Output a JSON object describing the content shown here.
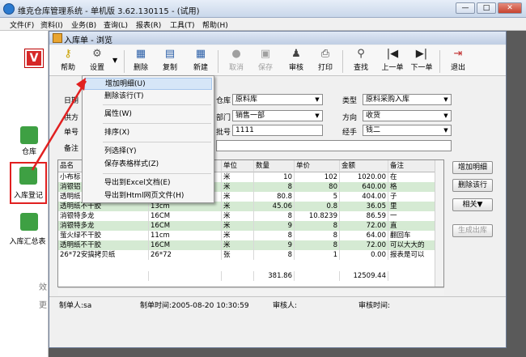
{
  "app": {
    "title": "维克仓库管理系统 - 单机版 3.62.130115 - (试用)",
    "winbtn_min": "—",
    "winbtn_max": "□",
    "winbtn_close": "✕"
  },
  "menu": [
    "文件(F)",
    "资料(I)",
    "业务(B)",
    "查询(L)",
    "报表(R)",
    "工具(T)",
    "帮助(H)"
  ],
  "left_panel": {
    "logo": "V",
    "items": [
      {
        "label": "仓库",
        "icon": "warehouse-icon",
        "color": "#3ea043"
      },
      {
        "label": "入库登记",
        "icon": "inbound-register-icon",
        "color": "#3ea043"
      },
      {
        "label": "入库汇总表",
        "icon": "inbound-summary-icon",
        "color": "#3ea043"
      }
    ],
    "fragment_1": "效",
    "fragment_2": "更"
  },
  "window": {
    "title": "入库单 - 浏览"
  },
  "toolbar": [
    {
      "label": "帮助",
      "icon": "help-key-icon",
      "glyph": "🔑",
      "enabled": true
    },
    {
      "label": "设置",
      "icon": "settings-icon",
      "glyph": "⚙",
      "enabled": true
    },
    {
      "label": "删除",
      "icon": "delete-icon",
      "glyph": "▦",
      "enabled": true
    },
    {
      "label": "复制",
      "icon": "copy-icon",
      "glyph": "▤",
      "enabled": true
    },
    {
      "label": "新建",
      "icon": "new-icon",
      "glyph": "▦",
      "enabled": true
    },
    {
      "label": "取消",
      "icon": "cancel-icon",
      "glyph": "●",
      "enabled": false
    },
    {
      "label": "保存",
      "icon": "save-icon",
      "glyph": "▣",
      "enabled": false
    },
    {
      "label": "审核",
      "icon": "audit-icon",
      "glyph": "♟",
      "enabled": true
    },
    {
      "label": "打印",
      "icon": "print-icon",
      "glyph": "⎙",
      "enabled": true
    },
    {
      "label": "查找",
      "icon": "find-icon",
      "glyph": "⚲",
      "enabled": true
    },
    {
      "label": "上一单",
      "icon": "prev-record-icon",
      "glyph": "|◀",
      "enabled": true
    },
    {
      "label": "下一单",
      "icon": "next-record-icon",
      "glyph": "▶|",
      "enabled": true
    },
    {
      "label": "退出",
      "icon": "exit-icon",
      "glyph": "⇥",
      "enabled": true
    }
  ],
  "form": {
    "date_label": "日期",
    "supplier_label": "供方",
    "docno_label": "单号",
    "remark_label": "备注",
    "warehouse_label_frag": "仓库",
    "warehouse_value": "原料库",
    "dept_label_frag": "部门",
    "dept_value": "销售一部",
    "num_label_frag": "批号",
    "num_value": "1111",
    "type_label": "类型",
    "type_value": "原料采购入库",
    "direction_label": "方向",
    "direction_value": "收货",
    "handler_label": "经手",
    "handler_value": "钱二"
  },
  "grid": {
    "headers": [
      "品名",
      "",
      "单位",
      "数量",
      "单价",
      "金额",
      "备注"
    ],
    "rows": [
      {
        "name": "小布标",
        "spec": "",
        "unit": "米",
        "qty": "10",
        "price": "102",
        "amount": "1020.00",
        "note": "在",
        "green": false
      },
      {
        "name": "消银铝",
        "spec": "",
        "unit": "米",
        "qty": "8",
        "price": "80",
        "amount": "640.00",
        "note": "格",
        "green": true
      },
      {
        "name": "透明纸",
        "spec": "",
        "unit": "米",
        "qty": "80.8",
        "price": "5",
        "amount": "404.00",
        "note": "子",
        "green": false
      },
      {
        "name": "透明纸不干胶",
        "spec": "13cm",
        "unit": "米",
        "qty": "45.06",
        "price": "0.8",
        "amount": "36.05",
        "note": "里",
        "green": true
      },
      {
        "name": "消银特多龙",
        "spec": "16CM",
        "unit": "米",
        "qty": "8",
        "price": "10.8239",
        "amount": "86.59",
        "note": "一",
        "green": false
      },
      {
        "name": "消银特多龙",
        "spec": "16CM",
        "unit": "米",
        "qty": "9",
        "price": "8",
        "amount": "72.00",
        "note": "直",
        "green": true
      },
      {
        "name": "萤火绿不干胶",
        "spec": "11cm",
        "unit": "米",
        "qty": "8",
        "price": "8",
        "amount": "64.00",
        "note": "翻回车",
        "green": false
      },
      {
        "name": "透明纸不干胶",
        "spec": "16CM",
        "unit": "米",
        "qty": "9",
        "price": "8",
        "amount": "72.00",
        "note": "可以大大的",
        "green": true
      },
      {
        "name": "26*72安搞拷贝纸",
        "spec": "26*72",
        "unit": "张",
        "qty": "8",
        "price": "1",
        "amount": "0.00",
        "note": "报表是可以",
        "green": false
      }
    ],
    "total_qty": "381.86",
    "total_amount": "12509.44"
  },
  "side_buttons": [
    "增加明细",
    "删除该行",
    "相关▼",
    "生成出库"
  ],
  "status": {
    "maker": "制单人:sa",
    "make_time": "制单时间:2005-08-20 10:30:59",
    "auditor": "审核人:",
    "audit_time": "审核时间:"
  },
  "context_menu": [
    {
      "label": "增加明细(U)",
      "highlight": true
    },
    {
      "label": "删除该行(T)",
      "highlight": false
    },
    {
      "label": "属性(W)",
      "highlight": false
    },
    {
      "label": "排序(X)",
      "highlight": false
    },
    {
      "label": "列选择(Y)",
      "highlight": false
    },
    {
      "label": "保存表格样式(Z)",
      "highlight": false
    },
    {
      "label": "导出到Excel文档(E)",
      "highlight": false
    },
    {
      "label": "导出到Html网页文件(H)",
      "highlight": false
    }
  ]
}
